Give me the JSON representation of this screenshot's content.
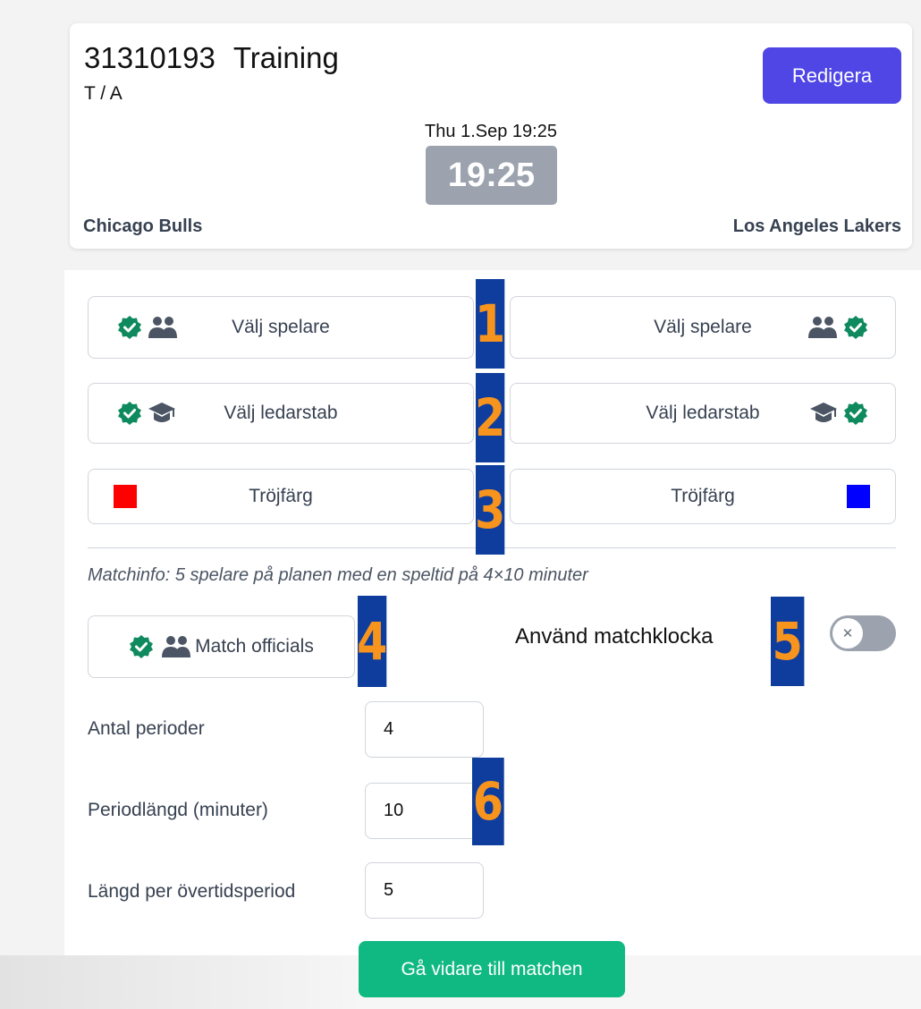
{
  "match": {
    "id": "31310193",
    "type": "Training",
    "subtitle": "T / A",
    "edit_label": "Redigera",
    "datetime": "Thu 1.Sep 19:25",
    "clock": "19:25",
    "home_team": "Chicago Bulls",
    "away_team": "Los Angeles Lakers"
  },
  "setup": {
    "players_label": "Välj spelare",
    "staff_label": "Välj ledarstab",
    "jersey_label": "Tröjfärg",
    "home_jersey_color": "#ff0000",
    "away_jersey_color": "#0000ff",
    "status_icon": "check-badge-icon",
    "players_icon": "users-icon",
    "staff_icon": "graduation-cap-icon"
  },
  "markers": [
    "1",
    "2",
    "3",
    "4",
    "5",
    "6"
  ],
  "match_info": "Matchinfo: 5 spelare på planen med en speltid på 4×10 minuter",
  "officials_label": "Match officials",
  "match_clock": {
    "label": "Använd matchklocka",
    "enabled": false
  },
  "fields": {
    "periods_label": "Antal perioder",
    "periods_value": "4",
    "period_length_label": "Periodlängd (minuter)",
    "period_length_value": "10",
    "overtime_label": "Längd per övertidsperiod",
    "overtime_value": "5"
  },
  "proceed_label": "Gå vidare till matchen",
  "colors": {
    "accent": "#4f46e5",
    "success": "#10b981",
    "check": "#0f8a5f",
    "marker_bg": "#0e3d9e",
    "marker_fg": "#f7941d"
  }
}
